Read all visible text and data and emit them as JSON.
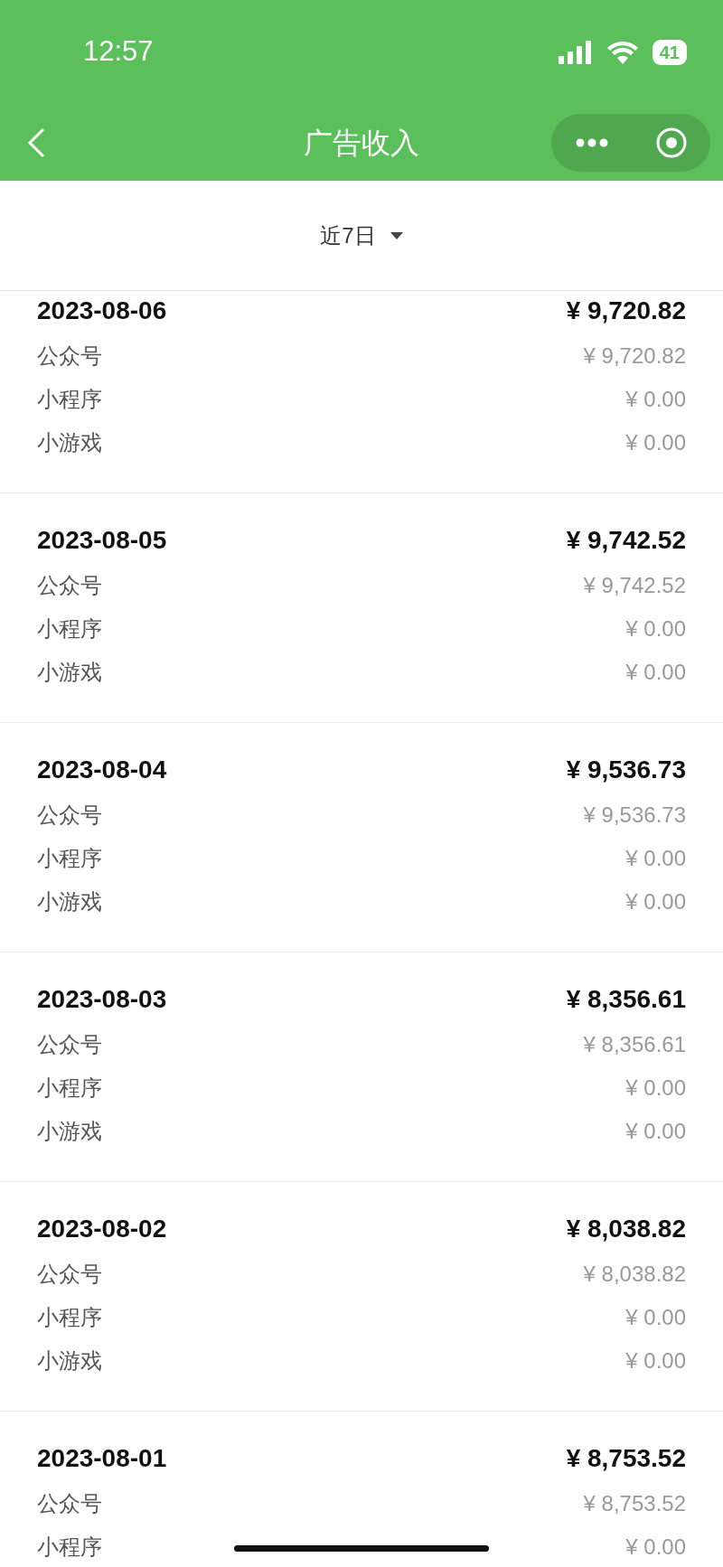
{
  "status_bar": {
    "time": "12:57",
    "battery": "41"
  },
  "nav": {
    "title": "广告收入"
  },
  "filter": {
    "label": "近7日"
  },
  "days": [
    {
      "date": "2023-08-06",
      "total": "¥ 9,720.82",
      "items": [
        {
          "label": "公众号",
          "amount": "¥ 9,720.82"
        },
        {
          "label": "小程序",
          "amount": "¥ 0.00"
        },
        {
          "label": "小游戏",
          "amount": "¥ 0.00"
        }
      ]
    },
    {
      "date": "2023-08-05",
      "total": "¥ 9,742.52",
      "items": [
        {
          "label": "公众号",
          "amount": "¥ 9,742.52"
        },
        {
          "label": "小程序",
          "amount": "¥ 0.00"
        },
        {
          "label": "小游戏",
          "amount": "¥ 0.00"
        }
      ]
    },
    {
      "date": "2023-08-04",
      "total": "¥ 9,536.73",
      "items": [
        {
          "label": "公众号",
          "amount": "¥ 9,536.73"
        },
        {
          "label": "小程序",
          "amount": "¥ 0.00"
        },
        {
          "label": "小游戏",
          "amount": "¥ 0.00"
        }
      ]
    },
    {
      "date": "2023-08-03",
      "total": "¥ 8,356.61",
      "items": [
        {
          "label": "公众号",
          "amount": "¥ 8,356.61"
        },
        {
          "label": "小程序",
          "amount": "¥ 0.00"
        },
        {
          "label": "小游戏",
          "amount": "¥ 0.00"
        }
      ]
    },
    {
      "date": "2023-08-02",
      "total": "¥ 8,038.82",
      "items": [
        {
          "label": "公众号",
          "amount": "¥ 8,038.82"
        },
        {
          "label": "小程序",
          "amount": "¥ 0.00"
        },
        {
          "label": "小游戏",
          "amount": "¥ 0.00"
        }
      ]
    },
    {
      "date": "2023-08-01",
      "total": "¥ 8,753.52",
      "items": [
        {
          "label": "公众号",
          "amount": "¥ 8,753.52"
        },
        {
          "label": "小程序",
          "amount": "¥ 0.00"
        }
      ]
    }
  ]
}
